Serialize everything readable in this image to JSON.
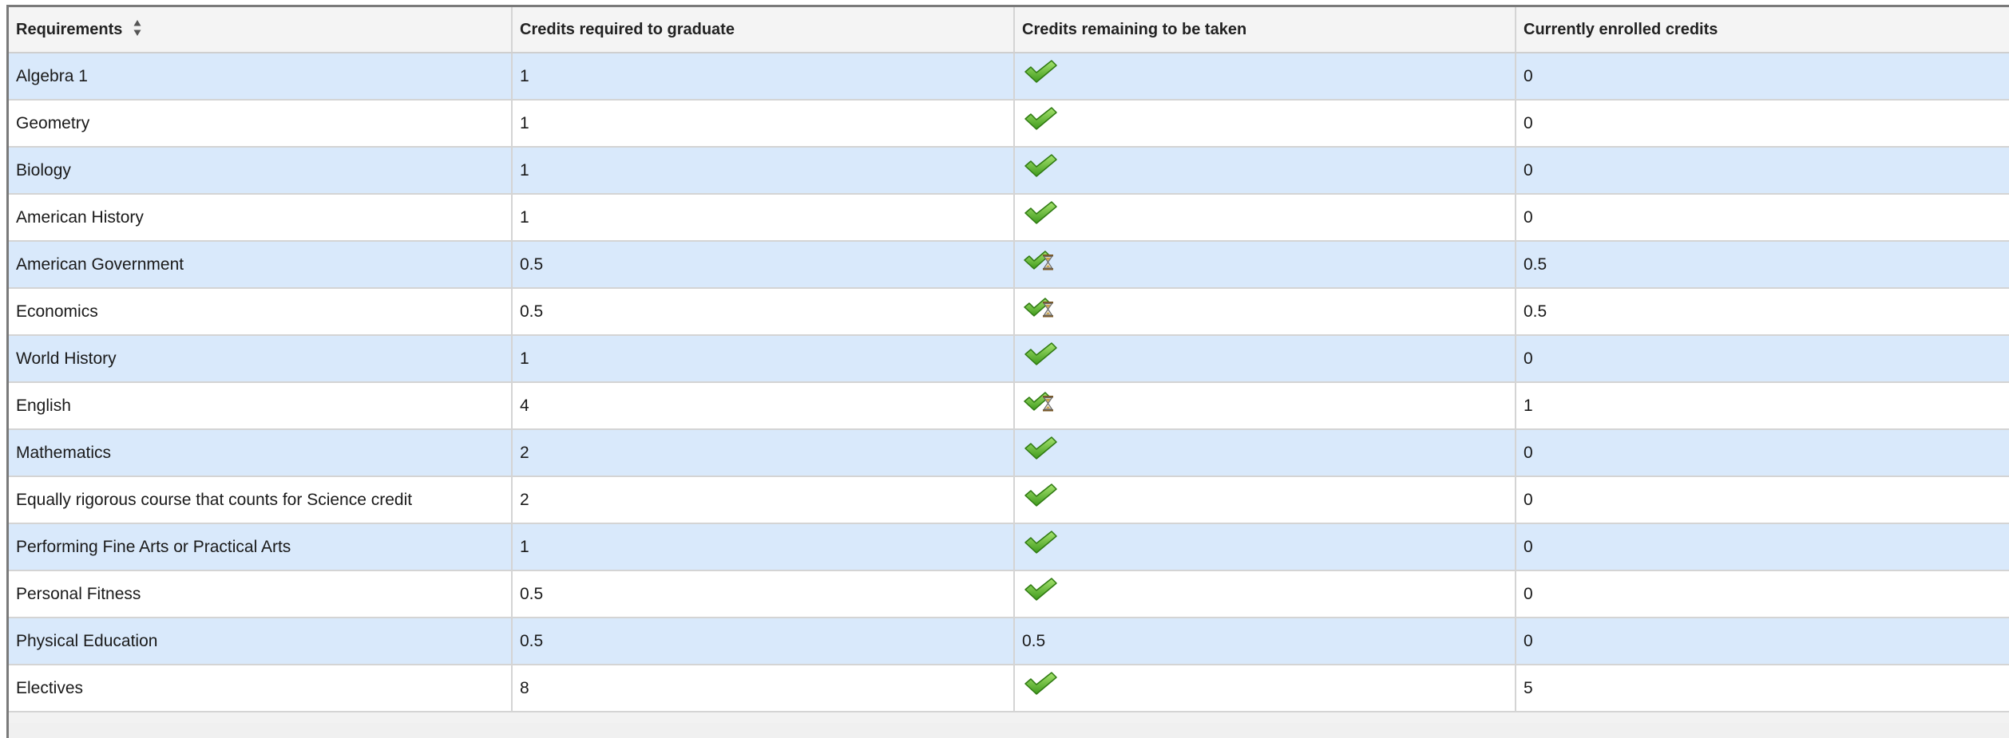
{
  "table": {
    "headers": {
      "requirements": "Requirements",
      "credits_required": "Credits required to graduate",
      "credits_remaining": "Credits remaining to be taken",
      "currently_enrolled": "Currently enrolled credits"
    },
    "rows": [
      {
        "requirement": "Algebra 1",
        "required": "1",
        "remaining_status": "check",
        "remaining": "",
        "enrolled": "0"
      },
      {
        "requirement": "Geometry",
        "required": "1",
        "remaining_status": "check",
        "remaining": "",
        "enrolled": "0"
      },
      {
        "requirement": "Biology",
        "required": "1",
        "remaining_status": "check",
        "remaining": "",
        "enrolled": "0"
      },
      {
        "requirement": "American History",
        "required": "1",
        "remaining_status": "check",
        "remaining": "",
        "enrolled": "0"
      },
      {
        "requirement": "American Government",
        "required": "0.5",
        "remaining_status": "in-progress",
        "remaining": "",
        "enrolled": "0.5"
      },
      {
        "requirement": "Economics",
        "required": "0.5",
        "remaining_status": "in-progress",
        "remaining": "",
        "enrolled": "0.5"
      },
      {
        "requirement": "World History",
        "required": "1",
        "remaining_status": "check",
        "remaining": "",
        "enrolled": "0"
      },
      {
        "requirement": "English",
        "required": "4",
        "remaining_status": "in-progress",
        "remaining": "",
        "enrolled": "1"
      },
      {
        "requirement": "Mathematics",
        "required": "2",
        "remaining_status": "check",
        "remaining": "",
        "enrolled": "0"
      },
      {
        "requirement": "Equally rigorous course that counts for Science credit",
        "required": "2",
        "remaining_status": "check",
        "remaining": "",
        "enrolled": "0"
      },
      {
        "requirement": "Performing Fine Arts or Practical Arts",
        "required": "1",
        "remaining_status": "check",
        "remaining": "",
        "enrolled": "0"
      },
      {
        "requirement": "Personal Fitness",
        "required": "0.5",
        "remaining_status": "check",
        "remaining": "",
        "enrolled": "0"
      },
      {
        "requirement": "Physical Education",
        "required": "0.5",
        "remaining_status": "text",
        "remaining": "0.5",
        "enrolled": "0"
      },
      {
        "requirement": "Electives",
        "required": "8",
        "remaining_status": "check",
        "remaining": "",
        "enrolled": "5"
      }
    ]
  },
  "icons": {
    "sort": "sort-icon",
    "check": "checkmark-icon",
    "in_progress": "checkmark-hourglass-icon"
  },
  "colors": {
    "row_alt": "#d9e9fb",
    "row_plain": "#ffffff",
    "header_bg": "#f4f4f4",
    "check_green": "#6cc43a",
    "grid_line": "#d4d4d4"
  }
}
